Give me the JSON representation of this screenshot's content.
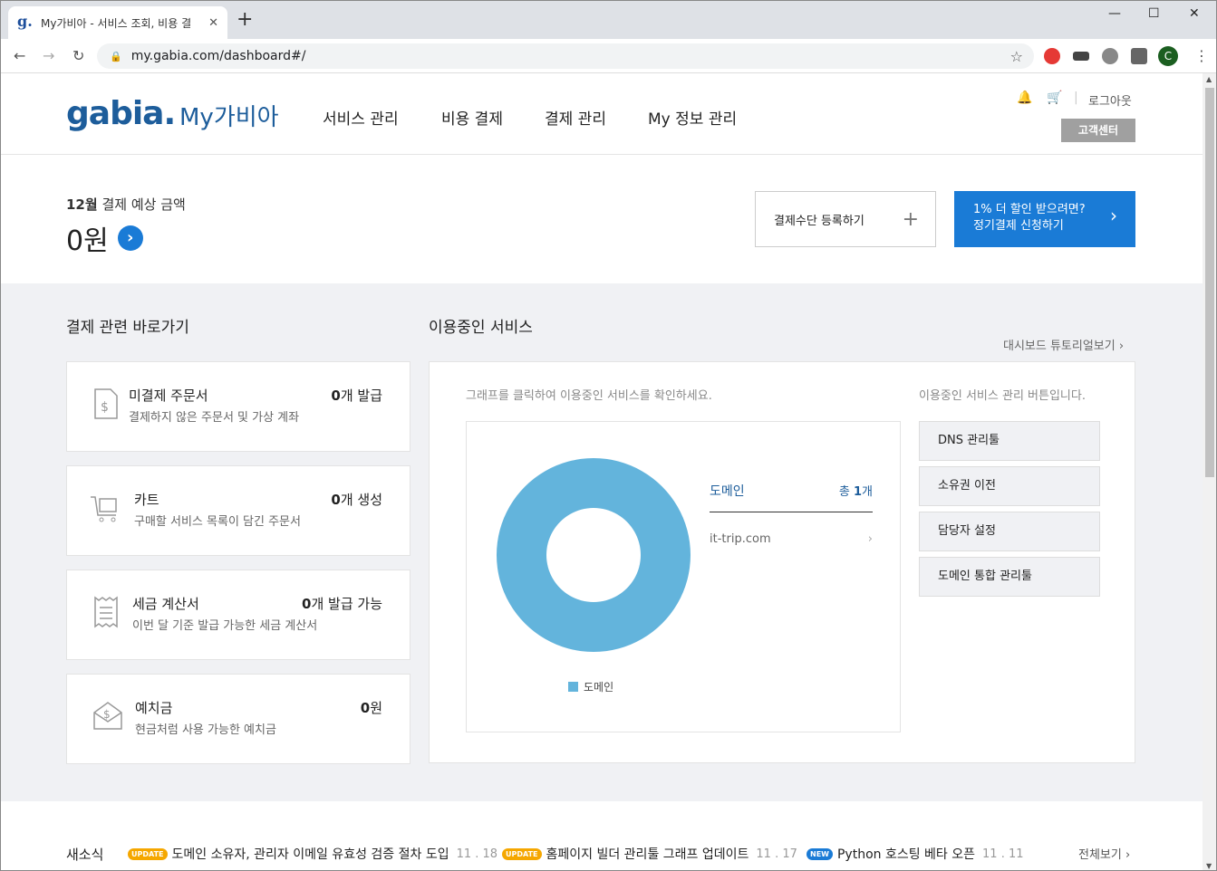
{
  "browser": {
    "tab_title": "My가비아 - 서비스 조회, 비용 결",
    "favicon": "g.",
    "url": "my.gabia.com/dashboard#/",
    "new_tab": "+",
    "avatar_letter": "C"
  },
  "header": {
    "logo": "gabia.",
    "site_name": "My가비아",
    "menu": [
      "서비스 관리",
      "비용 결제",
      "결제 관리",
      "My 정보 관리"
    ],
    "logout": "로그아웃",
    "customer_center": "고객센터"
  },
  "summary": {
    "month": "12월",
    "label": "결제 예상 금액",
    "amount": "0원",
    "pay_method_button": "결제수단 등록하기",
    "promo_line1": "1% 더 할인 받으려면?",
    "promo_line2": "정기결제 신청하기"
  },
  "shortcuts": {
    "title": "결제 관련 바로가기",
    "cards": [
      {
        "title": "미결제 주문서",
        "sub": "결제하지 않은 주문서 및 가상 계좌",
        "count": "0",
        "unit": "개 발급",
        "icon": "invoice-dollar-icon"
      },
      {
        "title": "카트",
        "sub": "구매할 서비스 목록이 담긴 주문서",
        "count": "0",
        "unit": "개 생성",
        "icon": "cart-icon"
      },
      {
        "title": "세금 계산서",
        "sub": "이번 달 기준 발급 가능한 세금 계산서",
        "count": "0",
        "unit": "개 발급 가능",
        "icon": "receipt-icon"
      },
      {
        "title": "예치금",
        "sub": "현금처럼 사용 가능한 예치금",
        "count": "0",
        "unit": "원",
        "icon": "deposit-envelope-icon"
      }
    ]
  },
  "services": {
    "title": "이용중인 서비스",
    "tutorial": "대시보드 튜토리얼보기",
    "chart_hint": "그래프를 클릭하여 이용중인 서비스를 확인하세요.",
    "buttons_hint": "이용중인 서비스 관리 버튼입니다.",
    "domain_header": "도메인",
    "total_prefix": "총 ",
    "total_count": "1",
    "total_unit": "개",
    "domain_item": "it-trip.com",
    "buttons": [
      "DNS 관리툴",
      "소유권 이전",
      "담당자 설정",
      "도메인 통합 관리툴"
    ],
    "color": "#63b4dc"
  },
  "chart_data": {
    "type": "pie",
    "donut": true,
    "categories": [
      "도메인"
    ],
    "values": [
      1
    ],
    "legend": [
      "도메인"
    ]
  },
  "news": {
    "label": "새소식",
    "items": [
      {
        "badge": "UPDATE",
        "text": "도메인 소유자, 관리자 이메일 유효성 검증 절차 도입",
        "date": "11 . 18"
      },
      {
        "badge": "UPDATE",
        "text": "홈페이지 빌더 관리툴 그래프 업데이트",
        "date": "11 . 17"
      },
      {
        "badge": "NEW",
        "text": "Python 호스팅 베타 오픈",
        "date": "11 . 11"
      }
    ],
    "all": "전체보기"
  }
}
